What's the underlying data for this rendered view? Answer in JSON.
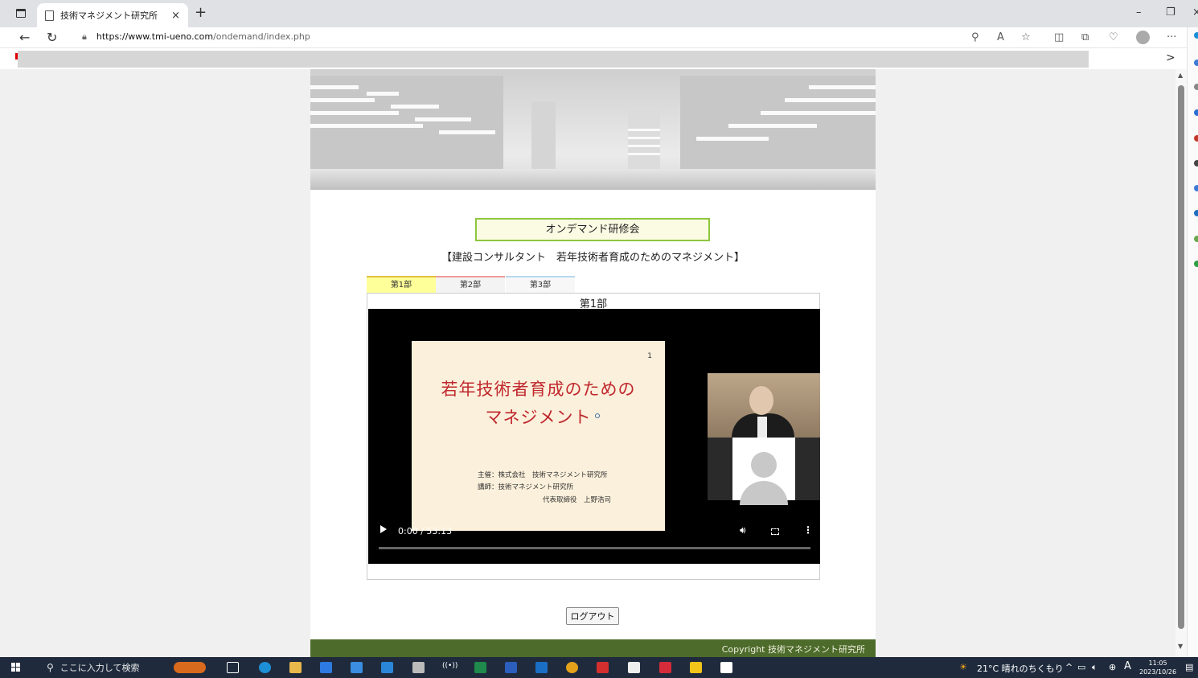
{
  "browser": {
    "tab_title": "技術マネジメント研究所",
    "tab_close": "×",
    "new_tab": "+",
    "url_host": "https://www.tmi-ueno.com",
    "url_path": "/ondemand/index.php",
    "fav_more": ">"
  },
  "page": {
    "ondemand_label": "オンデマンド研修会",
    "course_title": "【建設コンサルタント　若年技術者育成のためのマネジメント】",
    "tabs": [
      {
        "label": "第1部"
      },
      {
        "label": "第2部"
      },
      {
        "label": "第3部"
      }
    ],
    "panel_title": "第1部",
    "video": {
      "slide_number": "1",
      "slide_title_line1": "若年技術者育成のための",
      "slide_title_line2": "マネジメント",
      "slide_host": "主催：株式会社　技術マネジメント研究所",
      "slide_lecturer": "講師：技術マネジメント研究所",
      "slide_lecturer_role": "代表取締役　上野浩司",
      "time": "0:00 / 53:13",
      "progress": 0
    },
    "logout_label": "ログアウト",
    "footer": "Copyright 技術マネジメント研究所"
  },
  "taskbar": {
    "search_placeholder": "ここに入力して検索",
    "weather": "21°C  晴れのちくもり",
    "ime": "A",
    "time": "11:05",
    "date": "2023/10/26"
  },
  "colors": {
    "ondemand_border": "#8dc63f",
    "footer_bg": "#4d6b2a",
    "slide_title": "#c0282e",
    "taskbar_bg": "#1f2b3d"
  }
}
